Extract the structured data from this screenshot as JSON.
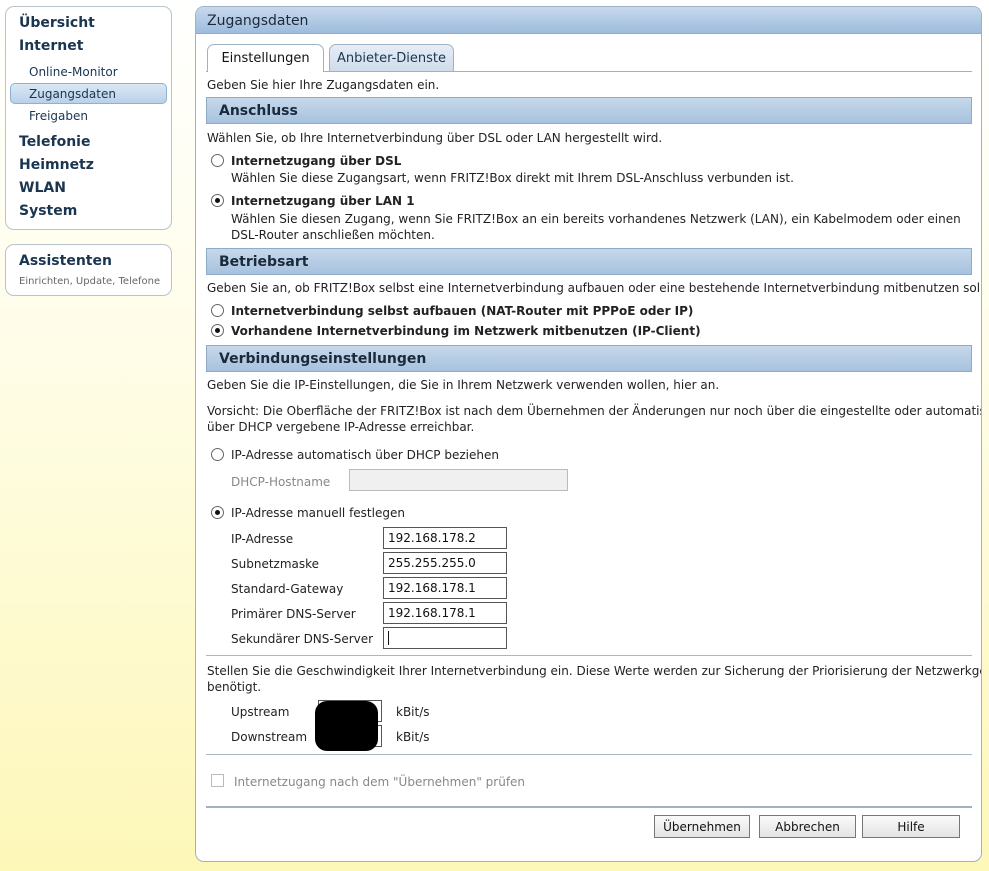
{
  "sidebar": {
    "items": [
      {
        "label": "Übersicht"
      },
      {
        "label": "Internet"
      },
      {
        "label": "Online-Monitor"
      },
      {
        "label": "Zugangsdaten"
      },
      {
        "label": "Freigaben"
      },
      {
        "label": "Telefonie"
      },
      {
        "label": "Heimnetz"
      },
      {
        "label": "WLAN"
      },
      {
        "label": "System"
      }
    ],
    "selected": "Zugangsdaten"
  },
  "assistant": {
    "title": "Assistenten",
    "subtitle": "Einrichten, Update, Telefone"
  },
  "panel": {
    "title": "Zugangsdaten",
    "tabs": [
      {
        "label": "Einstellungen"
      },
      {
        "label": "Anbieter-Dienste"
      }
    ],
    "intro": "Geben Sie hier Ihre Zugangsdaten ein."
  },
  "anschluss": {
    "heading": "Anschluss",
    "desc": "Wählen Sie, ob Ihre Internetverbindung über DSL oder LAN hergestellt wird.",
    "options": [
      {
        "label": "Internetzugang über DSL",
        "desc": "Wählen Sie diese Zugangsart, wenn FRITZ!Box direkt mit Ihrem DSL-Anschluss verbunden ist.",
        "selected": false
      },
      {
        "label": "Internetzugang über LAN 1",
        "desc1": "Wählen Sie diesen Zugang, wenn Sie FRITZ!Box an ein bereits vorhandenes Netzwerk (LAN), ein Kabelmodem oder einen",
        "desc2": "DSL-Router anschließen möchten.",
        "selected": true
      }
    ]
  },
  "betriebsart": {
    "heading": "Betriebsart",
    "desc": "Geben Sie an, ob FRITZ!Box selbst eine Internetverbindung aufbauen oder eine bestehende Internetverbindung mitbenutzen soll.",
    "options": [
      {
        "label": "Internetverbindung selbst aufbauen (NAT-Router mit PPPoE oder IP)",
        "selected": false
      },
      {
        "label": "Vorhandene Internetverbindung im Netzwerk mitbenutzen (IP-Client)",
        "selected": true
      }
    ]
  },
  "verbindung": {
    "heading": "Verbindungseinstellungen",
    "desc": "Geben Sie die IP-Einstellungen, die Sie in Ihrem Netzwerk verwenden wollen, hier an.",
    "warning1": "Vorsicht: Die Oberfläche der FRITZ!Box ist nach dem Übernehmen der Änderungen nur noch über die eingestellte oder automatisch",
    "warning2": "über DHCP vergebene IP-Adresse erreichbar.",
    "dhcp_option": "IP-Adresse automatisch über DHCP beziehen",
    "dhcp_hostname_label": "DHCP-Hostname",
    "dhcp_hostname_value": "",
    "manual_option": "IP-Adresse manuell festlegen",
    "fields": [
      {
        "label": "IP-Adresse",
        "value": "192.168.178.2"
      },
      {
        "label": "Subnetzmaske",
        "value": "255.255.255.0"
      },
      {
        "label": "Standard-Gateway",
        "value": "192.168.178.1"
      },
      {
        "label": "Primärer DNS-Server",
        "value": "192.168.178.1"
      },
      {
        "label": "Sekundärer DNS-Server",
        "value": ""
      }
    ]
  },
  "speed": {
    "desc1": "Stellen Sie die Geschwindigkeit Ihrer Internetverbindung ein. Diese Werte werden zur Sicherung der Priorisierung der Netzwerkgeräte",
    "desc2": "benötigt.",
    "upstream_label": "Upstream",
    "downstream_label": "Downstream",
    "unit": "kBit/s"
  },
  "check": {
    "label": "Internetzugang nach dem \"Übernehmen\" prüfen",
    "checked": false
  },
  "buttons": {
    "apply": "Übernehmen",
    "cancel": "Abbrechen",
    "help": "Hilfe"
  },
  "colors": {
    "section_bg": "#b5cce4",
    "panel_border": "#9fb2c4",
    "nav_text": "#1a3550"
  }
}
